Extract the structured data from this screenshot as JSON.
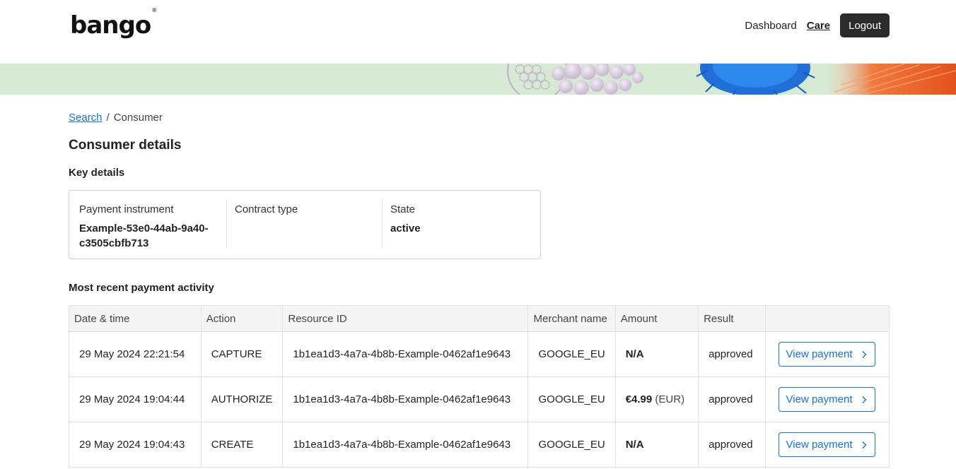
{
  "header": {
    "logo_text": "bango",
    "logo_mark": "®",
    "nav": {
      "dashboard": "Dashboard",
      "care": "Care",
      "logout": "Logout"
    }
  },
  "breadcrumb": {
    "link": "Search",
    "separator": "/",
    "current": "Consumer"
  },
  "page_title": "Consumer details",
  "key_details": {
    "title": "Key details",
    "columns": [
      {
        "label": "Payment instrument",
        "value": "Example-53e0-44ab-9a40-c3505cbfb713"
      },
      {
        "label": "Contract type",
        "value": ""
      },
      {
        "label": "State",
        "value": "active"
      }
    ]
  },
  "activity": {
    "title": "Most recent payment activity",
    "headers": [
      "Date & time",
      "Action",
      "Resource ID",
      "Merchant name",
      "Amount",
      "Result",
      ""
    ],
    "rows": [
      {
        "datetime": "29 May 2024 22:21:54",
        "action": "CAPTURE",
        "resource_id": "1b1ea1d3-4a7a-4b8b-Example-0462af1e9643",
        "merchant": "GOOGLE_EU",
        "amount": "N/A",
        "currency": "",
        "result": "approved",
        "button": "View payment"
      },
      {
        "datetime": "29 May 2024 19:04:44",
        "action": "AUTHORIZE",
        "resource_id": "1b1ea1d3-4a7a-4b8b-Example-0462af1e9643",
        "merchant": "GOOGLE_EU",
        "amount": "€4.99",
        "currency": "(EUR)",
        "result": "approved",
        "button": "View payment"
      },
      {
        "datetime": "29 May 2024 19:04:43",
        "action": "CREATE",
        "resource_id": "1b1ea1d3-4a7a-4b8b-Example-0462af1e9643",
        "merchant": "GOOGLE_EU",
        "amount": "N/A",
        "currency": "",
        "result": "approved",
        "button": "View payment"
      }
    ]
  },
  "colors": {
    "link": "#1a6fd8",
    "banner_bg": "#d6ead3",
    "logout_bg": "#2b2b2b"
  }
}
